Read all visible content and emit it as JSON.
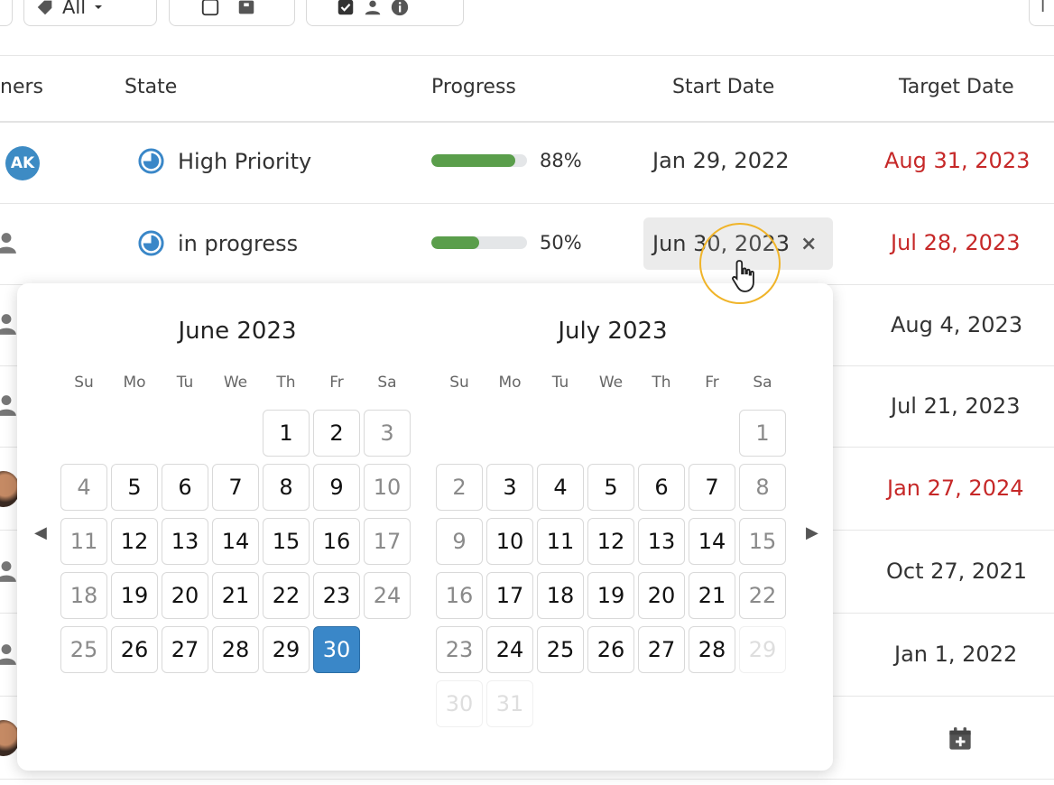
{
  "toolbar": {
    "filter_label": "All",
    "right_button_label": "I"
  },
  "columns": {
    "owners": "ners",
    "state": "State",
    "progress": "Progress",
    "start_date": "Start Date",
    "target_date": "Target Date"
  },
  "rows": [
    {
      "owner": "AK",
      "state": "High Priority",
      "progress_pct": 88,
      "progress_label": "88%",
      "start": "Jan 29, 2022",
      "target": "Aug 31, 2023",
      "target_overdue": true
    },
    {
      "state": "in progress",
      "progress_pct": 50,
      "progress_label": "50%",
      "start": "Jun 30, 2023",
      "target": "Jul 28, 2023",
      "target_overdue": true
    },
    {
      "target": "Aug 4, 2023",
      "target_overdue": false
    },
    {
      "target": "Jul 21, 2023",
      "target_overdue": false
    },
    {
      "target": "Jan 27, 2024",
      "target_overdue": true
    },
    {
      "target": "Oct 27, 2021",
      "target_overdue": false
    },
    {
      "target": "Jan 1, 2022",
      "target_overdue": false
    }
  ],
  "date_chip": {
    "value": "Jun 30, 2023",
    "clear": "×"
  },
  "calendar": {
    "weekdays": [
      "Su",
      "Mo",
      "Tu",
      "We",
      "Th",
      "Fr",
      "Sa"
    ],
    "months": [
      {
        "title": "June 2023",
        "first_weekday": 4,
        "days": 30,
        "selected": 30,
        "disabled_from": null,
        "trailing": []
      },
      {
        "title": "July 2023",
        "first_weekday": 6,
        "days": 28,
        "selected": null,
        "disabled_from": 29,
        "trailing": [
          "29",
          "30",
          "31"
        ]
      }
    ]
  },
  "colors": {
    "accent": "#3a87c8",
    "progress": "#5a9e4b",
    "overdue": "#c62828",
    "cursor_ring": "#f0b429"
  },
  "icons": {
    "state": "clock-circle-icon",
    "owner": "user-icon",
    "add_date": "calendar-plus-icon"
  }
}
